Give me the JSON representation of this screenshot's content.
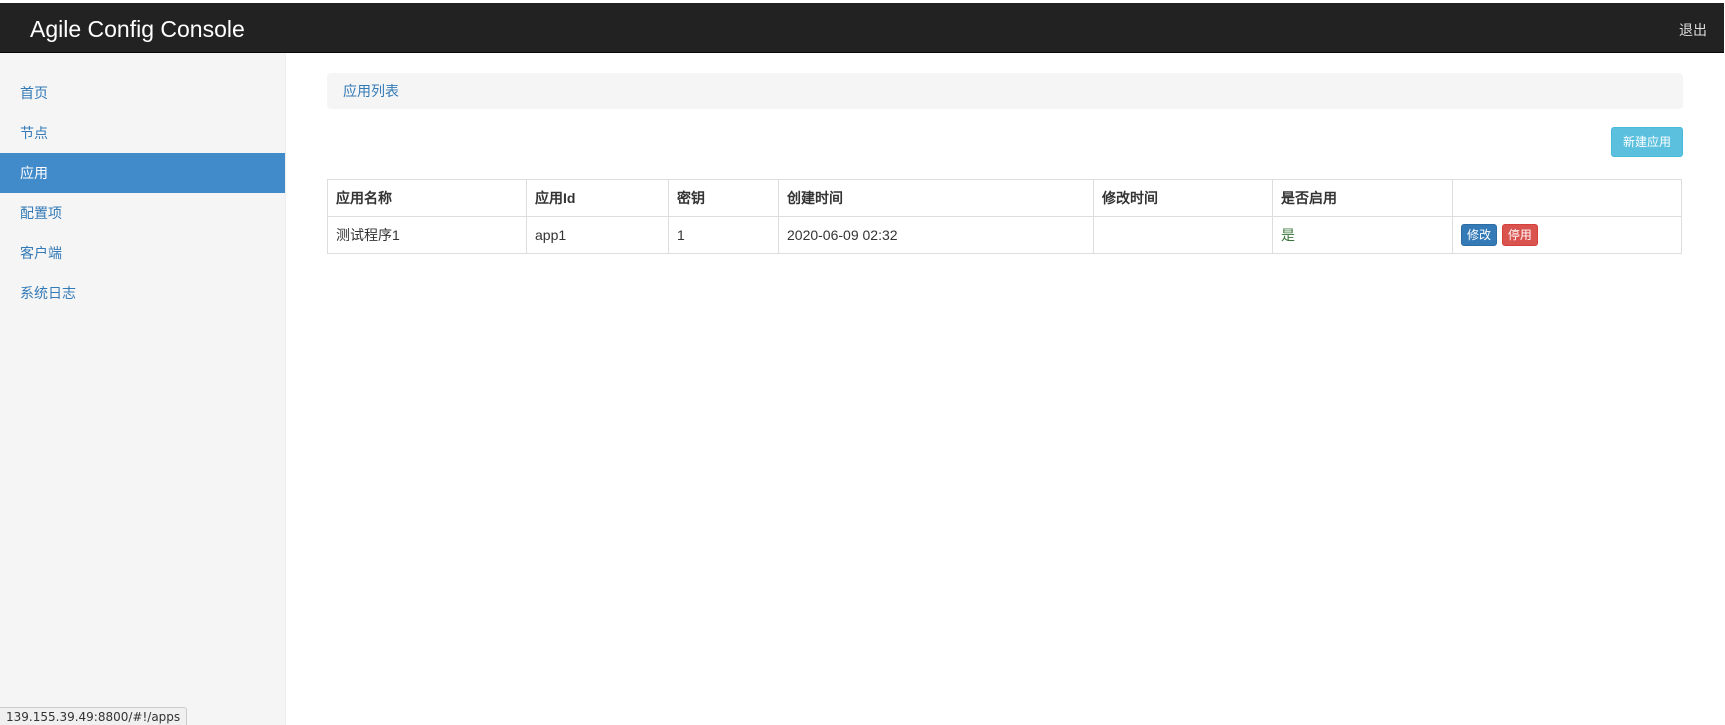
{
  "header": {
    "brand": "Agile Config Console",
    "logout_label": "退出"
  },
  "sidebar": {
    "items": [
      {
        "label": "首页",
        "active": false
      },
      {
        "label": "节点",
        "active": false
      },
      {
        "label": "应用",
        "active": true
      },
      {
        "label": "配置项",
        "active": false
      },
      {
        "label": "客户端",
        "active": false
      },
      {
        "label": "系统日志",
        "active": false
      }
    ]
  },
  "main": {
    "breadcrumb": "应用列表",
    "new_button_label": "新建应用",
    "table": {
      "columns": [
        "应用名称",
        "应用Id",
        "密钥",
        "创建时间",
        "修改时间",
        "是否启用",
        ""
      ],
      "rows": [
        {
          "name": "测试程序1",
          "app_id": "app1",
          "secret": "1",
          "created": "2020-06-09 02:32",
          "modified": "",
          "enabled": "是",
          "edit_label": "修改",
          "disable_label": "停用"
        }
      ]
    }
  },
  "statusbar": {
    "url": "139.155.39.49:8800/#!/apps"
  },
  "colors": {
    "topbar": "#222222",
    "sidebar_active": "#428bca",
    "link": "#337ab7",
    "info_button": "#5bc0de",
    "danger_button": "#d9534f",
    "success_text": "#3c763d"
  }
}
